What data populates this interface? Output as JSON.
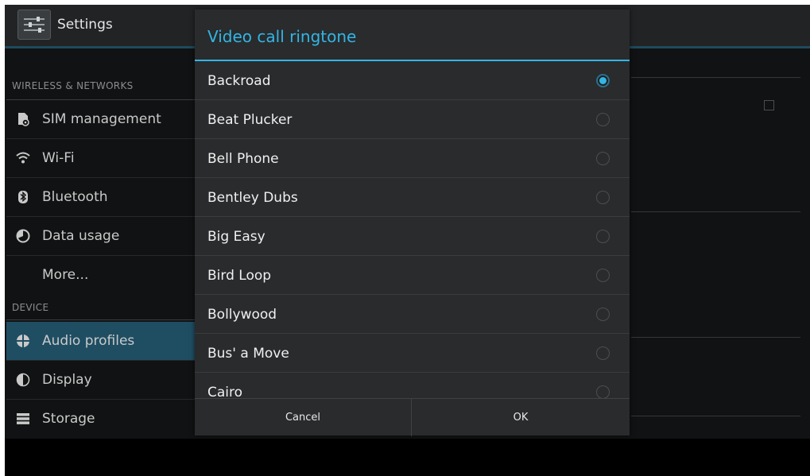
{
  "app": {
    "title": "Settings",
    "icon": "settings-sliders-icon"
  },
  "sidebar": {
    "sections": [
      {
        "header": "WIRELESS & NETWORKS",
        "items": [
          {
            "label": "SIM management",
            "icon": "sim-card-icon"
          },
          {
            "label": "Wi-Fi",
            "icon": "wifi-icon"
          },
          {
            "label": "Bluetooth",
            "icon": "bluetooth-icon"
          },
          {
            "label": "Data usage",
            "icon": "data-usage-icon"
          },
          {
            "label": "More...",
            "icon": ""
          }
        ]
      },
      {
        "header": "DEVICE",
        "items": [
          {
            "label": "Audio profiles",
            "icon": "audio-profiles-icon",
            "selected": true
          },
          {
            "label": "Display",
            "icon": "display-icon"
          },
          {
            "label": "Storage",
            "icon": "storage-icon"
          }
        ]
      }
    ]
  },
  "dialog": {
    "title": "Video call ringtone",
    "options": [
      {
        "label": "Backroad",
        "checked": true
      },
      {
        "label": "Beat Plucker",
        "checked": false
      },
      {
        "label": "Bell Phone",
        "checked": false
      },
      {
        "label": "Bentley Dubs",
        "checked": false
      },
      {
        "label": "Big Easy",
        "checked": false
      },
      {
        "label": "Bird Loop",
        "checked": false
      },
      {
        "label": "Bollywood",
        "checked": false
      },
      {
        "label": "Bus' a Move",
        "checked": false
      },
      {
        "label": "Cairo",
        "checked": false
      }
    ],
    "cancel_label": "Cancel",
    "ok_label": "OK"
  },
  "colors": {
    "accent": "#33b5e5",
    "selected_item_bg": "#1f4e63",
    "dialog_bg": "#292b2d",
    "screen_bg": "#111213"
  }
}
